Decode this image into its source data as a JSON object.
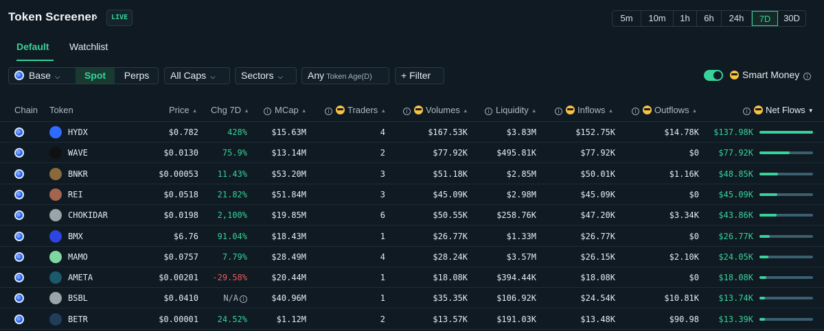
{
  "header": {
    "title": "Token Screener",
    "live_badge": "LIVE",
    "timeframes": [
      "5m",
      "10m",
      "1h",
      "6h",
      "24h",
      "7D",
      "30D"
    ],
    "active_timeframe": "7D"
  },
  "tabs": {
    "default": "Default",
    "watchlist": "Watchlist"
  },
  "filters": {
    "chain": "Base",
    "spot": "Spot",
    "perps": "Perps",
    "caps": "All Caps",
    "sectors": "Sectors",
    "age_prefix": "Any",
    "age_label": "Token Age(D)",
    "filter": "+ Filter",
    "smart_money_label": "Smart Money",
    "smart_money_enabled": true
  },
  "table": {
    "columns": {
      "chain": "Chain",
      "token": "Token",
      "price": "Price",
      "chg": "Chg 7D",
      "mcap": "MCap",
      "traders": "Traders",
      "volumes": "Volumes",
      "liquidity": "Liquidity",
      "inflows": "Inflows",
      "outflows": "Outflows",
      "netflows": "Net Flows"
    },
    "rows": [
      {
        "token": "HYDX",
        "price": "$0.782",
        "chg": "428%",
        "chg_dir": "up",
        "mcap": "$15.63M",
        "traders": "4",
        "volumes": "$167.53K",
        "liquidity": "$3.83M",
        "inflows": "$152.75K",
        "outflows": "$14.78K",
        "netflows": "$137.98K",
        "bar": 1.0,
        "icon_color": "#2f6bff"
      },
      {
        "token": "WAVE",
        "price": "$0.0130",
        "chg": "75.9%",
        "chg_dir": "up",
        "mcap": "$13.14M",
        "traders": "2",
        "volumes": "$77.92K",
        "liquidity": "$495.81K",
        "inflows": "$77.92K",
        "outflows": "$0",
        "netflows": "$77.92K",
        "bar": 0.56,
        "icon_color": "#111111"
      },
      {
        "token": "BNKR",
        "price": "$0.00053",
        "chg": "11.43%",
        "chg_dir": "up",
        "mcap": "$53.20M",
        "traders": "3",
        "volumes": "$51.18K",
        "liquidity": "$2.85M",
        "inflows": "$50.01K",
        "outflows": "$1.16K",
        "netflows": "$48.85K",
        "bar": 0.35,
        "icon_color": "#8a6a3a"
      },
      {
        "token": "REI",
        "price": "$0.0518",
        "chg": "21.82%",
        "chg_dir": "up",
        "mcap": "$51.84M",
        "traders": "3",
        "volumes": "$45.09K",
        "liquidity": "$2.98M",
        "inflows": "$45.09K",
        "outflows": "$0",
        "netflows": "$45.09K",
        "bar": 0.33,
        "icon_color": "#a5644e"
      },
      {
        "token": "CHOKIDAR",
        "price": "$0.0198",
        "chg": "2,100%",
        "chg_dir": "up",
        "mcap": "$19.85M",
        "traders": "6",
        "volumes": "$50.55K",
        "liquidity": "$258.76K",
        "inflows": "$47.20K",
        "outflows": "$3.34K",
        "netflows": "$43.86K",
        "bar": 0.32,
        "icon_color": "#9aa4ab"
      },
      {
        "token": "BMX",
        "price": "$6.76",
        "chg": "91.04%",
        "chg_dir": "up",
        "mcap": "$18.43M",
        "traders": "1",
        "volumes": "$26.77K",
        "liquidity": "$1.33M",
        "inflows": "$26.77K",
        "outflows": "$0",
        "netflows": "$26.77K",
        "bar": 0.19,
        "icon_color": "#2d45e0"
      },
      {
        "token": "MAMO",
        "price": "$0.0757",
        "chg": "7.79%",
        "chg_dir": "up",
        "mcap": "$28.49M",
        "traders": "4",
        "volumes": "$28.24K",
        "liquidity": "$3.57M",
        "inflows": "$26.15K",
        "outflows": "$2.10K",
        "netflows": "$24.05K",
        "bar": 0.17,
        "icon_color": "#7fd6a0"
      },
      {
        "token": "AMETA",
        "price": "$0.00201",
        "chg": "-29.58%",
        "chg_dir": "down",
        "mcap": "$20.44M",
        "traders": "1",
        "volumes": "$18.08K",
        "liquidity": "$394.44K",
        "inflows": "$18.08K",
        "outflows": "$0",
        "netflows": "$18.08K",
        "bar": 0.13,
        "icon_color": "#1a5a6a"
      },
      {
        "token": "BSBL",
        "price": "$0.0410",
        "chg": "N/A",
        "chg_dir": "na",
        "mcap": "$40.96M",
        "traders": "1",
        "volumes": "$35.35K",
        "liquidity": "$106.92K",
        "inflows": "$24.54K",
        "outflows": "$10.81K",
        "netflows": "$13.74K",
        "bar": 0.1,
        "icon_color": "#9aa4ab"
      },
      {
        "token": "BETR",
        "price": "$0.00001",
        "chg": "24.52%",
        "chg_dir": "up",
        "mcap": "$1.12M",
        "traders": "2",
        "volumes": "$13.57K",
        "liquidity": "$191.03K",
        "inflows": "$13.48K",
        "outflows": "$90.98",
        "netflows": "$13.39K",
        "bar": 0.1,
        "icon_color": "#1f3e5a"
      }
    ]
  }
}
